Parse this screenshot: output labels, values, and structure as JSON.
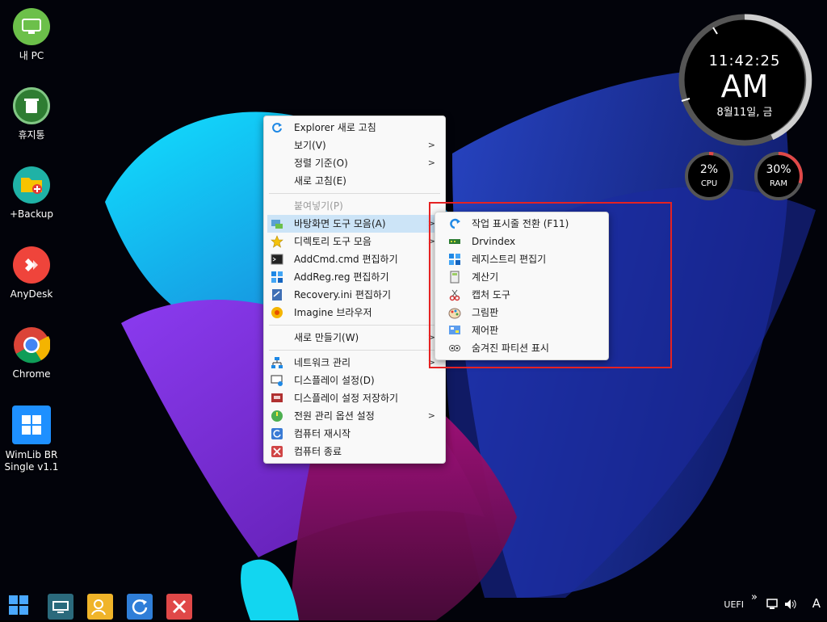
{
  "desktop_icons": [
    {
      "label": "내 PC",
      "icon": "monitor-icon",
      "color": "#6cc04a"
    },
    {
      "label": "휴지통",
      "icon": "recycle-bin-icon",
      "color": "#4caf50"
    },
    {
      "label": "+Backup",
      "icon": "folder-add-icon",
      "color": "#1fb2a6"
    },
    {
      "label": "AnyDesk",
      "icon": "anydesk-icon",
      "color": "#ef443b"
    },
    {
      "label": "Chrome",
      "icon": "chrome-icon",
      "color": "#4285f4"
    },
    {
      "label": "WimLib BR\nSingle v1.1",
      "icon": "windows-icon",
      "color": "#1e90ff"
    }
  ],
  "clock": {
    "time": "11:42:25",
    "ampm": "AM",
    "date": "8월11일, 금"
  },
  "cpu": {
    "value": "2%",
    "label": "CPU",
    "level": 0.02,
    "color": "#e04848"
  },
  "ram": {
    "value": "30%",
    "label": "RAM",
    "level": 0.3,
    "color": "#e04848"
  },
  "context_menu": {
    "items": [
      {
        "label": "Explorer 새로 고침",
        "icon": "refresh-icon"
      },
      {
        "label": "보기(V)",
        "submenu": true
      },
      {
        "label": "정렬 기준(O)",
        "submenu": true
      },
      {
        "label": "새로 고침(E)"
      },
      {
        "label": "붙여넣기(P)",
        "disabled": true
      },
      {
        "label": "바탕화면 도구 모음(A)",
        "icon": "desktop-tools-icon",
        "submenu": true,
        "highlighted": true
      },
      {
        "label": "디렉토리 도구 모음",
        "icon": "star-icon",
        "submenu": true
      },
      {
        "label": "AddCmd.cmd 편집하기",
        "icon": "cmd-icon"
      },
      {
        "label": "AddReg.reg 편집하기",
        "icon": "registry-icon"
      },
      {
        "label": "Recovery.ini 편집하기",
        "icon": "ini-file-icon"
      },
      {
        "label": "Imagine 브라우저",
        "icon": "imagine-icon"
      },
      {
        "label": "새로 만들기(W)",
        "submenu": true
      },
      {
        "label": "네트워크 관리",
        "icon": "network-icon",
        "submenu": true
      },
      {
        "label": "디스플레이 설정(D)",
        "icon": "display-settings-icon"
      },
      {
        "label": "디스플레이 설정 저장하기",
        "icon": "display-save-icon"
      },
      {
        "label": "전원 관리 옵션 설정",
        "icon": "power-options-icon",
        "submenu": true
      },
      {
        "label": "컴퓨터 재시작",
        "icon": "restart-icon"
      },
      {
        "label": "컴퓨터 종료",
        "icon": "shutdown-icon"
      }
    ]
  },
  "submenu": {
    "items": [
      {
        "label": "작업 표시줄 전환 (F11)",
        "icon": "taskbar-switch-icon"
      },
      {
        "label": "Drvindex",
        "icon": "drvindex-icon"
      },
      {
        "label": "레지스트리 편집기",
        "icon": "registry-editor-icon"
      },
      {
        "label": "계산기",
        "icon": "calculator-icon"
      },
      {
        "label": "캡처 도구",
        "icon": "snipping-tool-icon"
      },
      {
        "label": "그림판",
        "icon": "paint-icon"
      },
      {
        "label": "제어판",
        "icon": "control-panel-icon"
      },
      {
        "label": "숨겨진 파티션 표시",
        "icon": "hidden-partition-icon"
      }
    ]
  },
  "submenu_arrow": ">",
  "tray": {
    "uefi": "UEFI",
    "expand": "»",
    "ime": "A"
  },
  "colors": {
    "highlight": "#cce4f7",
    "red_box": "#e52222"
  }
}
